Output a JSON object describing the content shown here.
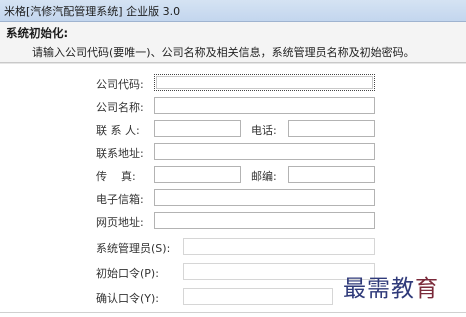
{
  "window": {
    "title": "米格[汽修汽配管理系统] 企业版 3.0"
  },
  "header": {
    "title": "系统初始化:",
    "instruction": "请输入公司代码(要唯一)、公司名称及相关信息，系统管理员名称及初始密码。"
  },
  "form": {
    "company_code": {
      "label": "公司代码:",
      "value": ""
    },
    "company_name": {
      "label": "公司名称:",
      "value": ""
    },
    "contact_person": {
      "label": "联 系 人:",
      "value": ""
    },
    "phone": {
      "label": "电话:",
      "value": ""
    },
    "address": {
      "label": "联系地址:",
      "value": ""
    },
    "fax": {
      "label": "传    真:",
      "value": ""
    },
    "postcode": {
      "label": "邮编:",
      "value": ""
    },
    "email": {
      "label": "电子信箱:",
      "value": ""
    },
    "website": {
      "label": "网页地址:",
      "value": ""
    },
    "admin": {
      "label": "系统管理员(S):",
      "value": ""
    },
    "password": {
      "label": "初始口令(P):",
      "value": ""
    },
    "confirm_password": {
      "label": "确认口令(Y):",
      "value": ""
    }
  },
  "watermark": {
    "text_a": "最需教",
    "text_b": "育"
  }
}
